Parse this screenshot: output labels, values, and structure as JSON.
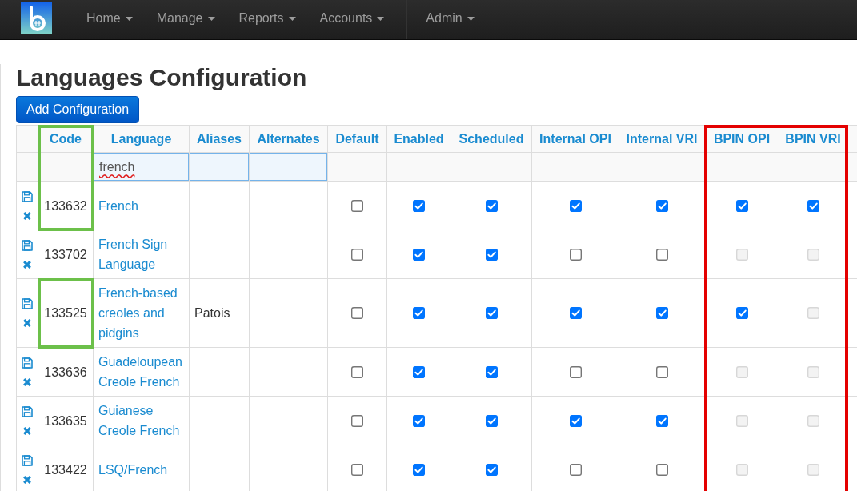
{
  "navbar": {
    "menus": [
      {
        "label": "Home"
      },
      {
        "label": "Manage"
      },
      {
        "label": "Reports"
      },
      {
        "label": "Accounts"
      }
    ],
    "secondary_menus": [
      {
        "label": "Admin"
      }
    ]
  },
  "page": {
    "title": "Languages Configuration",
    "add_button": "Add Configuration"
  },
  "table": {
    "columns": [
      {
        "kind": "actions",
        "filter": false
      },
      {
        "kind": "code",
        "label": "Code",
        "filter": false,
        "header_outline": {
          "color": "#6cc04a"
        }
      },
      {
        "kind": "language",
        "label": "Language",
        "filter": true,
        "filter_value": "french",
        "filter_misspelled": true
      },
      {
        "kind": "aliases",
        "label": "Aliases",
        "filter": true
      },
      {
        "kind": "alternates",
        "label": "Alternates",
        "filter": true
      },
      {
        "kind": "flag",
        "label": "Default",
        "filter": false
      },
      {
        "kind": "flag",
        "label": "Enabled",
        "filter": false
      },
      {
        "kind": "flag",
        "label": "Scheduled",
        "filter": false
      },
      {
        "kind": "flag",
        "label": "Internal OPI",
        "filter": false
      },
      {
        "kind": "flag",
        "label": "Internal VRI",
        "filter": false
      },
      {
        "kind": "flag",
        "label": "BPIN OPI",
        "filter": false,
        "outline": {
          "color": "#e40000"
        }
      },
      {
        "kind": "flag",
        "label": "BPIN VRI",
        "filter": false,
        "outline": {
          "color": "#e40000"
        }
      },
      {
        "kind": "partial",
        "filter": false
      }
    ],
    "rows": [
      {
        "code": "133632",
        "language": "French",
        "code_outline": {
          "color": "#6cc04a"
        },
        "flags": [
          {
            "checked": false,
            "disabled": false
          },
          {
            "checked": true,
            "disabled": false
          },
          {
            "checked": true,
            "disabled": false
          },
          {
            "checked": true,
            "disabled": false
          },
          {
            "checked": true,
            "disabled": false
          },
          {
            "checked": true,
            "disabled": false
          },
          {
            "checked": true,
            "disabled": false
          }
        ]
      },
      {
        "code": "133702",
        "language": "French Sign Language",
        "flags": [
          {
            "checked": false,
            "disabled": false
          },
          {
            "checked": true,
            "disabled": false
          },
          {
            "checked": true,
            "disabled": false
          },
          {
            "checked": false,
            "disabled": false
          },
          {
            "checked": false,
            "disabled": false
          },
          {
            "checked": false,
            "disabled": true
          },
          {
            "checked": false,
            "disabled": true
          }
        ]
      },
      {
        "code": "133525",
        "language": "French-based creoles and pidgins",
        "aliases": "Patois",
        "code_outline": {
          "color": "#6cc04a"
        },
        "flags": [
          {
            "checked": false,
            "disabled": false
          },
          {
            "checked": true,
            "disabled": false
          },
          {
            "checked": true,
            "disabled": false
          },
          {
            "checked": true,
            "disabled": false
          },
          {
            "checked": true,
            "disabled": false
          },
          {
            "checked": true,
            "disabled": false
          },
          {
            "checked": false,
            "disabled": true
          }
        ]
      },
      {
        "code": "133636",
        "language": "Guadeloupean Creole French",
        "flags": [
          {
            "checked": false,
            "disabled": false
          },
          {
            "checked": true,
            "disabled": false
          },
          {
            "checked": true,
            "disabled": false
          },
          {
            "checked": false,
            "disabled": false
          },
          {
            "checked": false,
            "disabled": false
          },
          {
            "checked": false,
            "disabled": true
          },
          {
            "checked": false,
            "disabled": true
          }
        ]
      },
      {
        "code": "133635",
        "language": "Guianese Creole French",
        "flags": [
          {
            "checked": false,
            "disabled": false
          },
          {
            "checked": true,
            "disabled": false
          },
          {
            "checked": true,
            "disabled": false
          },
          {
            "checked": true,
            "disabled": false
          },
          {
            "checked": true,
            "disabled": false
          },
          {
            "checked": false,
            "disabled": true
          },
          {
            "checked": false,
            "disabled": true
          }
        ]
      },
      {
        "code": "133422",
        "language": "LSQ/French",
        "flags": [
          {
            "checked": false,
            "disabled": false
          },
          {
            "checked": true,
            "disabled": false
          },
          {
            "checked": true,
            "disabled": false
          },
          {
            "checked": false,
            "disabled": false
          },
          {
            "checked": false,
            "disabled": false
          },
          {
            "checked": false,
            "disabled": true
          },
          {
            "checked": false,
            "disabled": true
          }
        ]
      }
    ]
  }
}
